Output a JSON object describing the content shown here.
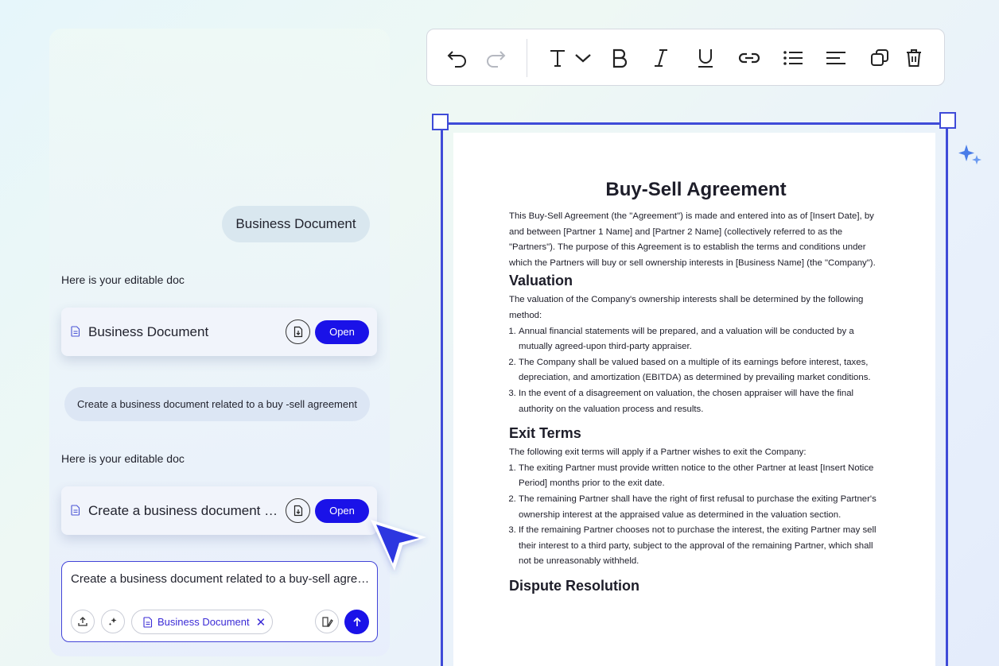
{
  "chat": {
    "user_bubble": "Business Document",
    "reply_1": "Here is your editable doc",
    "card_1": {
      "title": "Business Document",
      "open_label": "Open"
    },
    "prompt_bubble": "Create a business document related to a buy -sell agreement",
    "reply_2": "Here is your editable doc",
    "card_2": {
      "title": "Create a business document related to a buy-sell agreement",
      "open_label": "Open"
    },
    "composer": {
      "input_text": "Create a business document related to a buy-sell agreement",
      "chip_label": "Business Document",
      "chip_close": "✕"
    }
  },
  "toolbar": {
    "icons": [
      "undo-icon",
      "redo-icon",
      "text-style-icon",
      "chevron-down-icon",
      "bold-icon",
      "italic-icon",
      "underline-icon",
      "link-icon",
      "bullet-list-icon",
      "align-left-icon",
      "duplicate-icon",
      "delete-icon"
    ]
  },
  "document": {
    "title": "Buy-Sell Agreement",
    "intro": "This Buy-Sell Agreement (the \"Agreement\") is made and entered into as of [Insert Date], by and between [Partner 1 Name] and [Partner 2 Name] (collectively referred to as the \"Partners\"). The purpose of this Agreement is to establish the terms and conditions under which the Partners will buy or sell ownership interests in [Business Name] (the \"Company\").",
    "sections": [
      {
        "heading": "Valuation",
        "lead": "The valuation of the Company's ownership interests shall be determined by the following method:",
        "items": [
          "Annual financial statements will be prepared, and a valuation will be conducted by a mutually agreed-upon third-party appraiser.",
          "The Company shall be valued based on a multiple of its earnings before interest, taxes, depreciation, and amortization (EBITDA) as determined by prevailing market conditions.",
          "In the event of a disagreement on valuation, the chosen appraiser will have the final authority on the valuation process and results."
        ]
      },
      {
        "heading": "Exit Terms",
        "lead": "The following exit terms will apply if a Partner wishes to exit the Company:",
        "items": [
          "The exiting Partner must provide written notice to the other Partner at least [Insert Notice Period] months prior to the exit date.",
          "The remaining Partner shall have the right of first refusal to purchase the exiting Partner's ownership interest at the appraised value as determined in the valuation section.",
          "If the remaining Partner chooses not to purchase the interest, the exiting Partner may sell their interest to a third party, subject to the approval of the remaining Partner, which shall not be unreasonably withheld."
        ]
      },
      {
        "heading": "Dispute Resolution",
        "lead": "",
        "items": []
      }
    ]
  },
  "colors": {
    "accent": "#1a12e8",
    "frame": "#3f4bd8",
    "sparkle": "#4a7de8"
  }
}
